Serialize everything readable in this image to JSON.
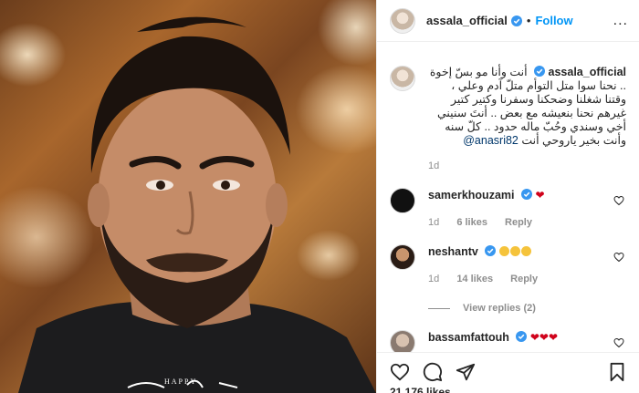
{
  "photo": {
    "caption": "HAPPY"
  },
  "header": {
    "username": "assala_official",
    "separator": "•",
    "follow_label": "Follow",
    "more_label": "..."
  },
  "caption": {
    "username": "assala_official",
    "text": "أنت وأنا مو بسّ إخوة .. نحنا سوا متل التوأم متلّ آدم وعلي ، وقتنا شغلنا وضحكنا وسفرنا وكتير كتير غيرهم نحنا بنعيشه مع بعض .. أنتَ سنيني أخي وسندي وحُبّ ماله حدود .. كلّ سنه وأنت بخير ياروحي أنت",
    "mention": "@anasri82",
    "time": "1d"
  },
  "comments": [
    {
      "username": "samerkhouzami",
      "time": "1d",
      "likes": "6 likes",
      "reply_label": "Reply"
    },
    {
      "username": "neshantv",
      "time": "1d",
      "likes": "14 likes",
      "reply_label": "Reply",
      "view_replies": "View replies (2)"
    },
    {
      "username": "bassamfattouh"
    }
  ],
  "footer": {
    "likes_count": "21,176 likes"
  },
  "colors": {
    "link": "#0095f6",
    "verified": "#3897f0",
    "muted": "#8e8e8e"
  }
}
